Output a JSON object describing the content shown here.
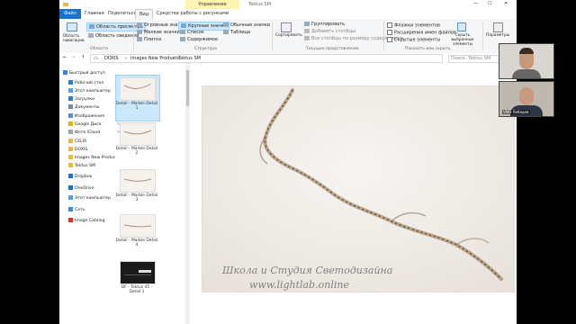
{
  "window": {
    "title": "Tektus SM",
    "context_tab": "Управление",
    "controls": [
      "—",
      "☐",
      "✕"
    ]
  },
  "ribbon": {
    "tabs": [
      "Файл",
      "Главная",
      "Поделиться",
      "Вид",
      "Средства работы с рисунками"
    ],
    "active_tab": "Вид",
    "panes": {
      "nav_area": "Область навигации",
      "preview": "Область просмотра",
      "details": "Область сведений",
      "label": "Области"
    },
    "layout": {
      "items": [
        "Огромные значки",
        "Крупные значки",
        "Обычные значки",
        "Мелкие значки",
        "Список",
        "Таблица",
        "Плитка",
        "Содержимое"
      ],
      "selected": "Крупные значки",
      "label": "Структура"
    },
    "current_view": {
      "sort": "Сортировать",
      "group": "Группировать",
      "add_columns": "Добавить столбцы",
      "fit_columns": "Все столбцы по размеру содержимого",
      "label": "Текущее представление"
    },
    "show_hide": {
      "checkboxes": "Флажки элементов",
      "extensions": "Расширения имен файлов",
      "hidden": "Скрытые элементы",
      "hide_selected": "Скрыть выбранные элементы",
      "label": "Показать или скрыть"
    },
    "options": "Параметры"
  },
  "address": {
    "path": [
      "DOXIS",
      "Images New Products",
      "Tektus SM"
    ],
    "search_placeholder": "Поиск: Tektus SM"
  },
  "nav": {
    "items": [
      {
        "label": "Быстрый доступ",
        "icon": "star-icon"
      },
      {
        "label": "Рабочий стол",
        "icon": "desktop-icon"
      },
      {
        "label": "Этот компьютер",
        "icon": "computer-icon"
      },
      {
        "label": "Загрузки",
        "icon": "download-icon"
      },
      {
        "label": "Документы",
        "icon": "document-icon"
      },
      {
        "label": "Изображения",
        "icon": "picture-icon"
      },
      {
        "label": "Google Диск",
        "icon": "drive-icon"
      },
      {
        "label": "Фото iCloud",
        "icon": "cloud-icon"
      },
      {
        "label": "CELIA",
        "icon": "folder-icon"
      },
      {
        "label": "DOXIS",
        "icon": "folder-icon"
      },
      {
        "label": "Images New Produc",
        "icon": "folder-icon"
      },
      {
        "label": "Tektus SM",
        "icon": "folder-icon"
      },
      {
        "label": "Dropbox",
        "icon": "dropbox-icon"
      },
      {
        "label": "OneDrive",
        "icon": "onedrive-icon"
      },
      {
        "label": "Этот компьютер",
        "icon": "computer-icon"
      },
      {
        "label": "Сеть",
        "icon": "network-icon"
      },
      {
        "label": "Image Catalog",
        "icon": "catalog-icon"
      }
    ]
  },
  "files": [
    {
      "name": "Detail - Marble Detail 1",
      "selected": true
    },
    {
      "name": "Detail - Marble Detail 2"
    },
    {
      "name": "Detail - Marble Detail 3"
    },
    {
      "name": "Detail - Marble Detail 4"
    },
    {
      "name": "DF - Tektus 45 - Detail 1"
    }
  ],
  "preview": {
    "watermark_line1": "Школа и Студия Светодизайна",
    "watermark_line2": "www.lightlab.online"
  },
  "video": {
    "participant_2": "VMD Лебедев"
  },
  "colors": {
    "accent": "#1a73c9",
    "context_tab": "#fff3b0",
    "selected": "#cce8ff"
  }
}
